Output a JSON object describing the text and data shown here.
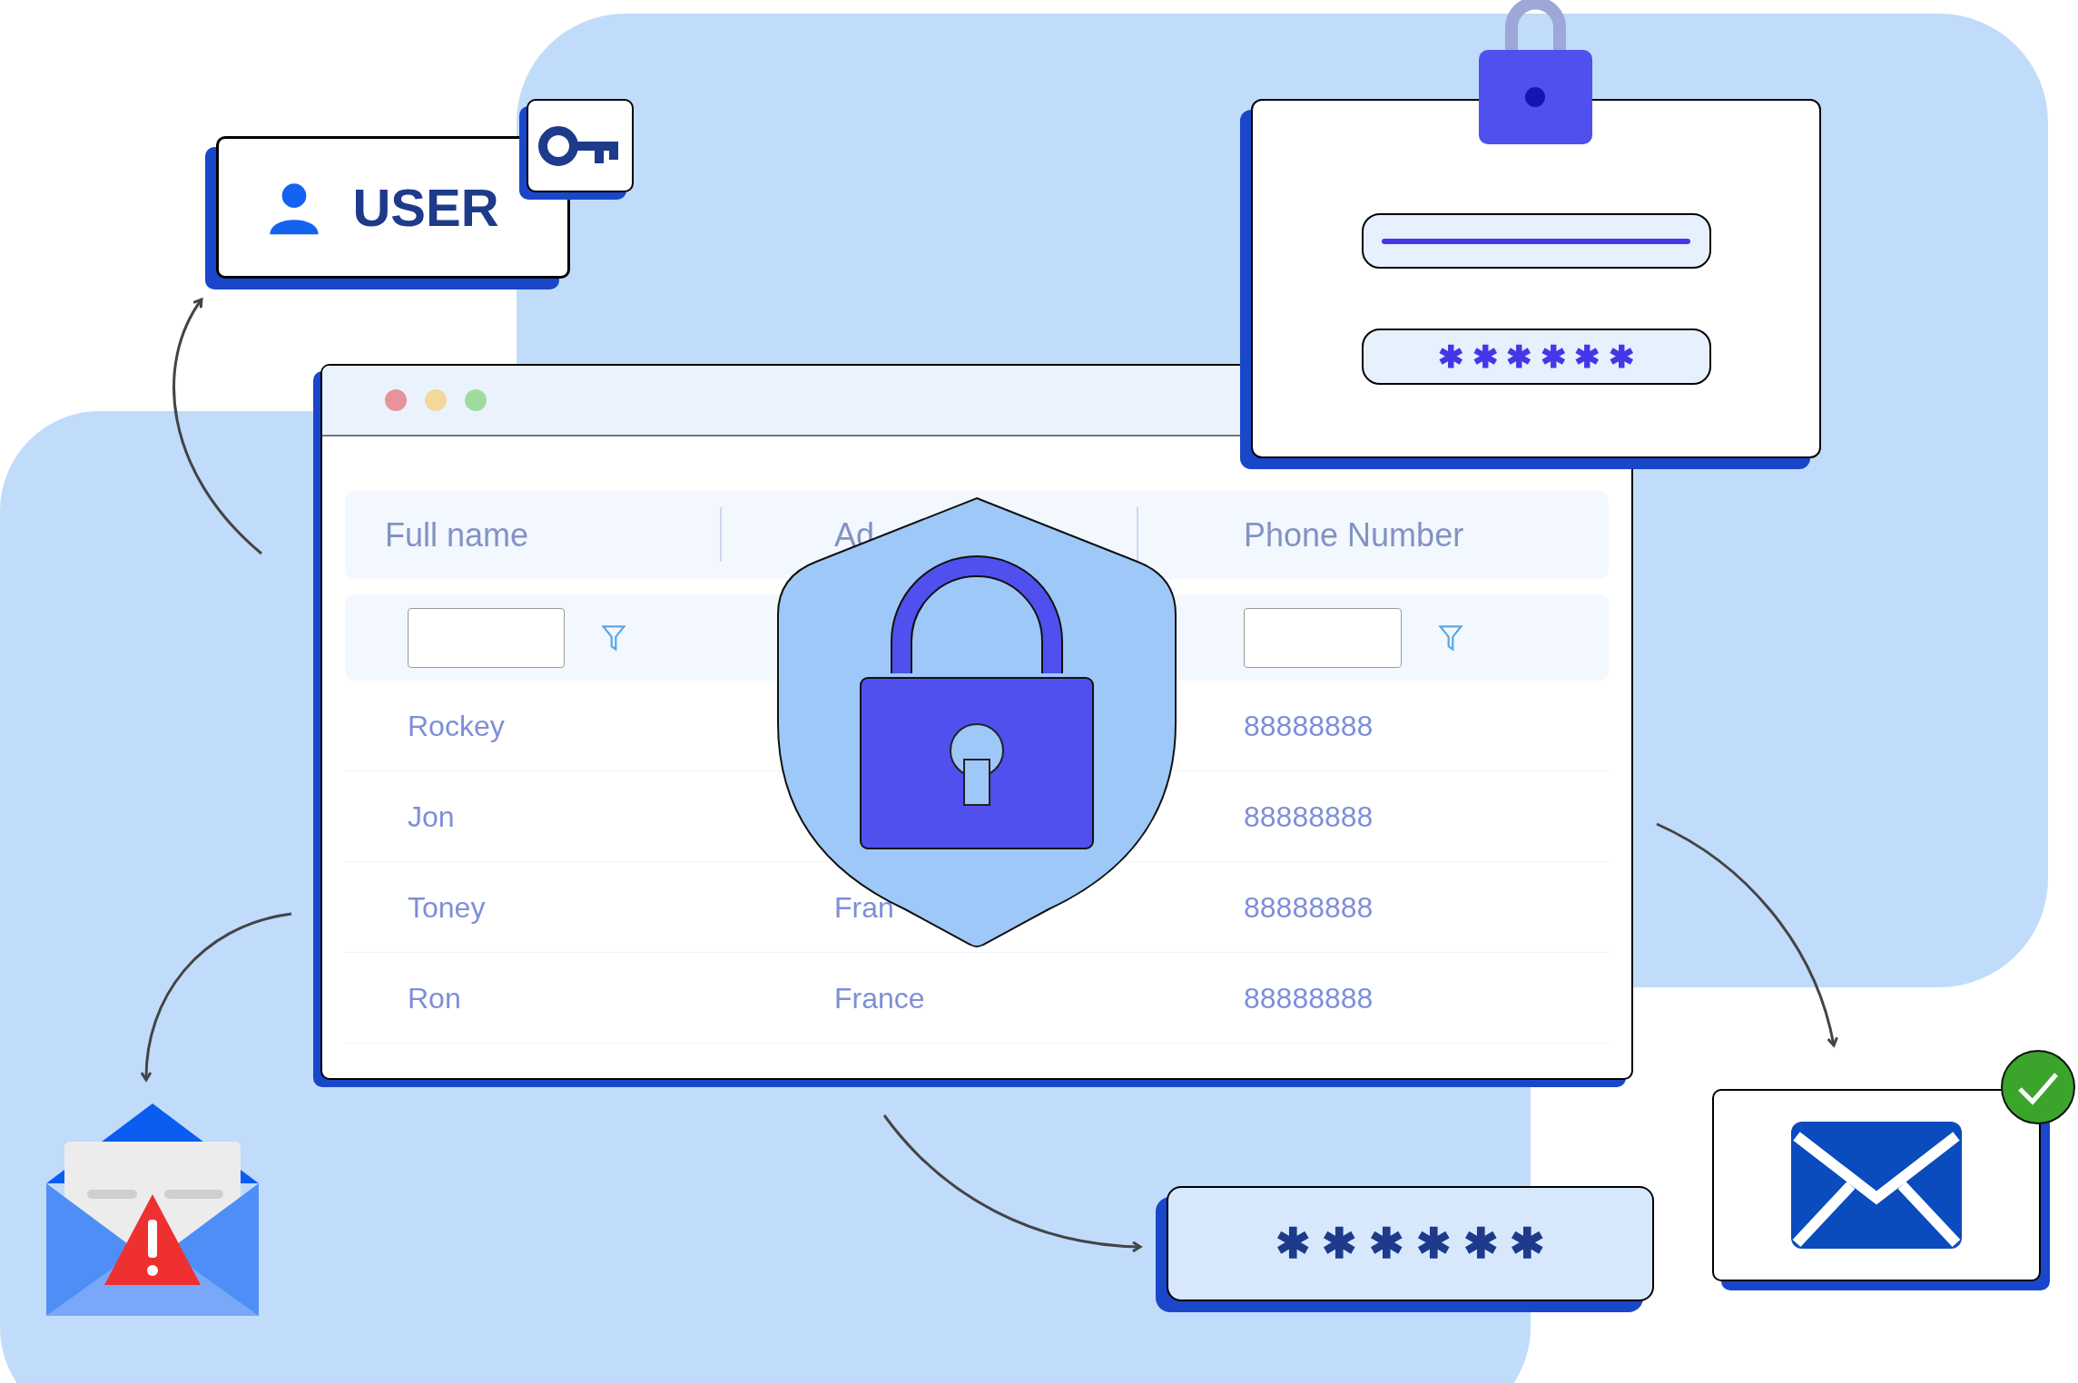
{
  "user_card": {
    "label": "USER"
  },
  "table": {
    "columns": [
      "Full name",
      "Ad",
      "Phone Number"
    ],
    "rows": [
      {
        "full_name": "Rockey",
        "phone": "88888888"
      },
      {
        "full_name": "Jon",
        "phone": "88888888"
      },
      {
        "full_name": "Toney",
        "address": "Fran",
        "phone": "88888888"
      },
      {
        "full_name": "Ron",
        "address": "France",
        "phone": "88888888"
      }
    ]
  },
  "login_card": {
    "password_mask": "✱ ✱ ✱ ✱ ✱ ✱"
  },
  "password_card": {
    "password_mask": "✱ ✱ ✱ ✱ ✱ ✱"
  }
}
